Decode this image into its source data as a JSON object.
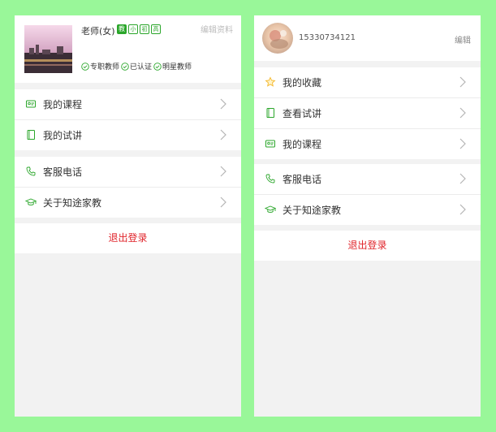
{
  "panel1": {
    "profile": {
      "name": "老师(女)",
      "badges": [
        "教",
        "小",
        "初",
        "高"
      ],
      "edit": "编辑资料",
      "tags": [
        "专职教师",
        "已认证",
        "明星教师"
      ]
    },
    "menu1": [
      {
        "label": "我的课程",
        "icon": "course-icon"
      },
      {
        "label": "我的试讲",
        "icon": "notebook-icon"
      }
    ],
    "menu2": [
      {
        "label": "客服电话",
        "icon": "phone-icon"
      },
      {
        "label": "关于知途家教",
        "icon": "graduation-cap-icon"
      }
    ],
    "logout": "退出登录"
  },
  "panel2": {
    "profile": {
      "phone": "15330734121",
      "edit": "编辑"
    },
    "menu1": [
      {
        "label": "我的收藏",
        "icon": "star-icon"
      },
      {
        "label": "查看试讲",
        "icon": "notebook-icon"
      },
      {
        "label": "我的课程",
        "icon": "course-icon"
      }
    ],
    "menu2": [
      {
        "label": "客服电话",
        "icon": "phone-icon"
      },
      {
        "label": "关于知途家教",
        "icon": "graduation-cap-icon"
      }
    ],
    "logout": "退出登录"
  },
  "colors": {
    "accent_green": "#2aa62a",
    "logout_red": "#e0242b",
    "background": "#99f799",
    "star": "#f5b72a"
  }
}
